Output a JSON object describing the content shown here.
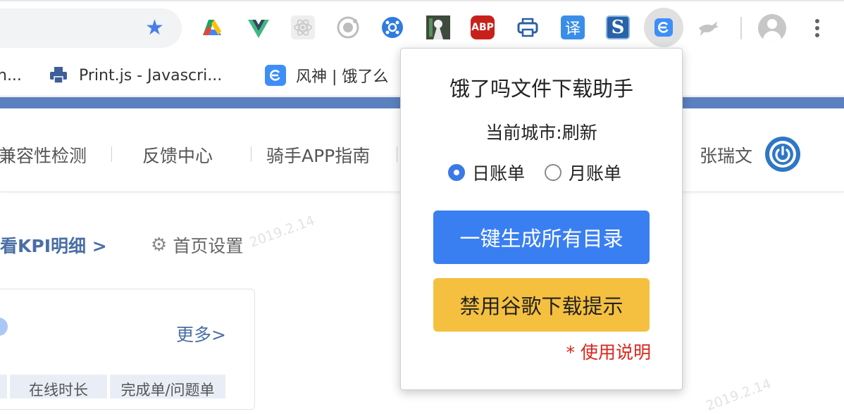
{
  "browser": {
    "extensions": [
      {
        "name": "google-drive-icon"
      },
      {
        "name": "vue-devtools-icon"
      },
      {
        "name": "react-devtools-icon"
      },
      {
        "name": "ionic-icon"
      },
      {
        "name": "bluetooth-ext-icon"
      },
      {
        "name": "anime-ext-icon"
      },
      {
        "name": "adblock-plus-icon",
        "label": "ABP"
      },
      {
        "name": "printer-ext-icon"
      },
      {
        "name": "translate-ext-icon",
        "label": "译"
      },
      {
        "name": "s-ext-icon",
        "label": "S"
      },
      {
        "name": "eleme-download-ext-icon"
      },
      {
        "name": "kangaroo-ext-icon"
      }
    ],
    "bookmarks": [
      {
        "label": "n..."
      },
      {
        "label": "Print.js - Javascri..."
      },
      {
        "label": "风神 | 饿了么"
      }
    ]
  },
  "page": {
    "nav": {
      "items": [
        "兼容性检测",
        "反馈中心",
        "骑手APP指南"
      ],
      "user_name": "张瑞文"
    },
    "kpi_link": "看KPI明细 >",
    "home_settings": "首页设置",
    "watermark": "2019.2.14",
    "card": {
      "more_link": "更多>",
      "columns": [
        "",
        "在线时长",
        "完成单/问题单"
      ]
    }
  },
  "popup": {
    "title": "饿了吗文件下载助手",
    "city_label": "当前城市:刷新",
    "radio_options": [
      {
        "label": "日账单",
        "checked": true
      },
      {
        "label": "月账单",
        "checked": false
      }
    ],
    "primary_button": "一键生成所有目录",
    "warning_button": "禁用谷歌下载提示",
    "usage_link": "* 使用说明"
  },
  "colors": {
    "accent_blue": "#3a7ff2",
    "warning_yellow": "#f5c040",
    "link_red": "#d9261c",
    "band_blue": "#5b80bf"
  }
}
